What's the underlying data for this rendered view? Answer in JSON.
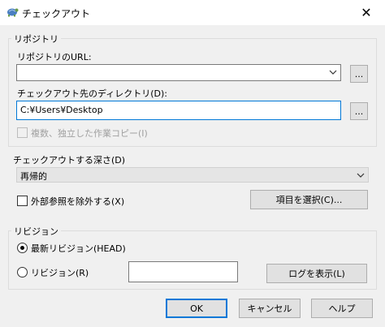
{
  "window": {
    "title": "チェックアウト",
    "close_glyph": "✕"
  },
  "repository": {
    "group_label": "リポジトリ",
    "url_label": "リポジトリのURL:",
    "url_value": "",
    "url_browse": "...",
    "dir_label": "チェックアウト先のディレクトリ(D):",
    "dir_value": "C:¥Users¥Desktop",
    "dir_browse": "...",
    "copy_option_label": "複数、独立した作業コピー(I)"
  },
  "depth": {
    "label": "チェックアウトする深さ(D)",
    "selected": "再帰的",
    "exclude_externals_label": "外部参照を除外する(X)",
    "choose_items_button": "項目を選択(C)..."
  },
  "revision": {
    "group_label": "リビジョン",
    "head_label": "最新リビジョン(HEAD)",
    "revision_label": "リビジョン(R)",
    "revision_value": "",
    "show_log_button": "ログを表示(L)"
  },
  "buttons": {
    "ok": "OK",
    "cancel": "キャンセル",
    "help": "ヘルプ"
  },
  "icons": {
    "app": "tortoise-icon",
    "combo": "chevron-down-icon"
  }
}
